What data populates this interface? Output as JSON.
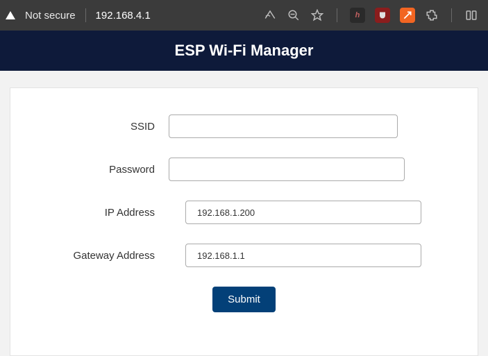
{
  "browser": {
    "security_text": "Not secure",
    "url": "192.168.4.1"
  },
  "header": {
    "title": "ESP Wi-Fi Manager"
  },
  "form": {
    "ssid": {
      "label": "SSID",
      "value": ""
    },
    "password": {
      "label": "Password",
      "value": ""
    },
    "ip": {
      "label": "IP Address",
      "value": "192.168.1.200"
    },
    "gateway": {
      "label": "Gateway Address",
      "value": "192.168.1.1"
    },
    "submit_label": "Submit"
  }
}
